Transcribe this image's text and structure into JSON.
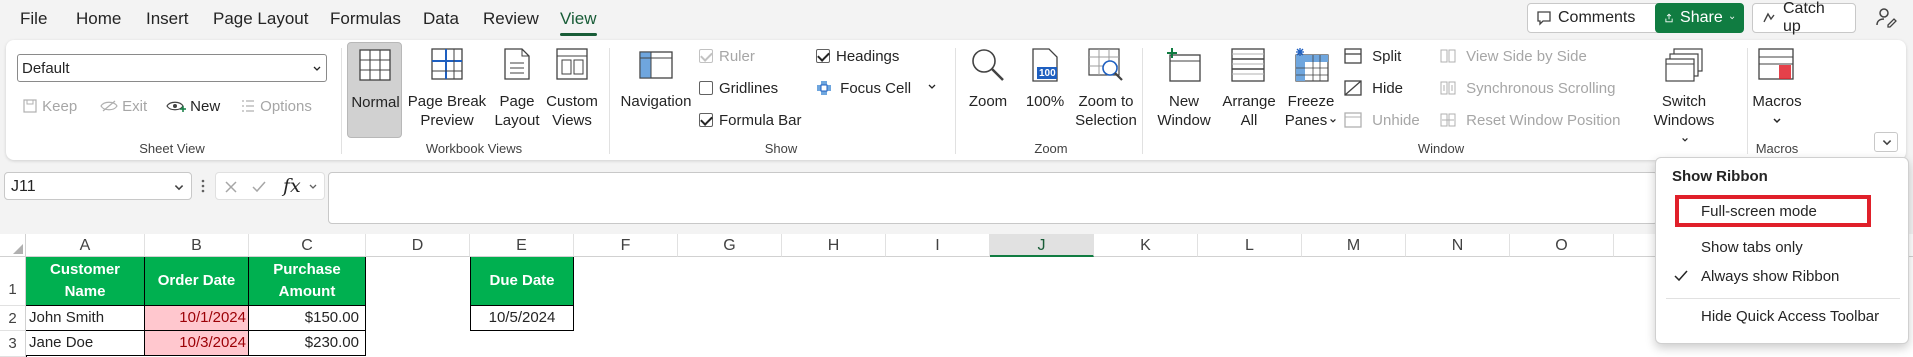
{
  "menu": {
    "tabs": [
      "File",
      "Home",
      "Insert",
      "Page Layout",
      "Formulas",
      "Data",
      "Review",
      "View"
    ],
    "active": "View"
  },
  "topbar": {
    "comments": "Comments",
    "share": "Share",
    "catchup": "Catch up"
  },
  "ribbon": {
    "sheet_view": {
      "select_value": "Default",
      "keep": "Keep",
      "exit": "Exit",
      "new": "New",
      "options": "Options",
      "label": "Sheet View"
    },
    "workbook_views": {
      "normal": "Normal",
      "page_break_1": "Page Break",
      "page_break_2": "Preview",
      "page_layout_1": "Page",
      "page_layout_2": "Layout",
      "custom_1": "Custom",
      "custom_2": "Views",
      "label": "Workbook Views"
    },
    "show": {
      "navigation": "Navigation",
      "ruler": "Ruler",
      "gridlines": "Gridlines",
      "formula_bar": "Formula Bar",
      "headings": "Headings",
      "focus_cell": "Focus Cell",
      "label": "Show"
    },
    "zoom": {
      "zoom": "Zoom",
      "hundred": "100%",
      "zoom_sel_1": "Zoom to",
      "zoom_sel_2": "Selection",
      "icon_text": "100",
      "label": "Zoom"
    },
    "window": {
      "new_1": "New",
      "new_2": "Window",
      "arrange_1": "Arrange",
      "arrange_2": "All",
      "freeze_1": "Freeze",
      "freeze_2": "Panes",
      "split": "Split",
      "hide": "Hide",
      "unhide": "Unhide",
      "side_by_side": "View Side by Side",
      "sync_scroll": "Synchronous Scrolling",
      "reset_pos": "Reset Window Position",
      "switch_1": "Switch",
      "switch_2": "Windows",
      "label": "Window"
    },
    "macros": {
      "macros": "Macros",
      "label": "Macros"
    }
  },
  "formula_bar": {
    "name_box": "J11",
    "fx": "fx"
  },
  "sheet": {
    "columns": [
      "A",
      "B",
      "C",
      "D",
      "E",
      "F",
      "G",
      "H",
      "I",
      "J",
      "K",
      "L",
      "M",
      "N",
      "O"
    ],
    "rows": [
      "1",
      "2",
      "3"
    ],
    "headers": {
      "a1_line1": "Customer",
      "a1_line2": "Name",
      "b1": "Order Date",
      "c1_line1": "Purchase",
      "c1_line2": "Amount",
      "e1": "Due Date"
    },
    "data": [
      {
        "name": "John Smith",
        "date": "10/1/2024",
        "amount": "$150.00"
      },
      {
        "name": "Jane Doe",
        "date": "10/3/2024",
        "amount": "$230.00"
      }
    ],
    "e2": "10/5/2024"
  },
  "dropdown": {
    "title": "Show Ribbon",
    "full_screen": "Full-screen mode",
    "tabs_only": "Show tabs only",
    "always": "Always show Ribbon",
    "hide_qat": "Hide Quick Access Toolbar",
    "highlight_color": "#e0202a"
  }
}
